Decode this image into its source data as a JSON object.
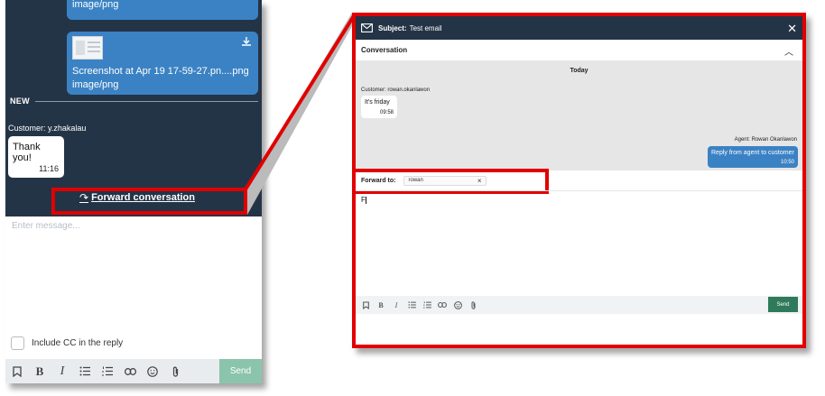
{
  "left_panel": {
    "attachment1": {
      "type_label": "image/png"
    },
    "attachment2": {
      "filename": "Screenshot at Apr 19 17-59-27.pn....png",
      "type_label": "image/png",
      "icon": "download-icon"
    },
    "new_separator": "NEW",
    "customer_label": "Customer: y.zhakalau",
    "message": {
      "text": "Thank you!",
      "time": "11:16"
    },
    "forward_link": "Forward conversation",
    "compose_placeholder": "Enter message...",
    "cc_label": "Include CC in the reply",
    "toolbar_icons": [
      "bookmark-icon",
      "bold-icon",
      "italic-icon",
      "bullet-list-icon",
      "numbered-list-icon",
      "link-icon",
      "emoji-icon",
      "attach-icon"
    ],
    "send_label": "Send",
    "colors": {
      "chat_bg": "#243447",
      "bubble_blue": "#3b82c4",
      "send_disabled": "#8bc4ac",
      "highlight_red": "#e10000"
    }
  },
  "right_panel": {
    "header": {
      "subject_label": "Subject:",
      "subject_value": "Test email"
    },
    "conversation_title": "Conversation",
    "today_label": "Today",
    "customer_label": "Customer: rowan.okanlawon",
    "customer_message": {
      "text": "It's friday",
      "time": "09:58"
    },
    "agent_label": "Agent: Rowan Okanlawon",
    "agent_message": {
      "text": "Reply from agent to customer",
      "time": "10:50"
    },
    "forward_to_label": "Forward to:",
    "forward_recipient": "rowan",
    "editor_text": "F",
    "send_label": "Send",
    "colors": {
      "header_bg": "#243447",
      "send": "#2f7a5b"
    }
  }
}
